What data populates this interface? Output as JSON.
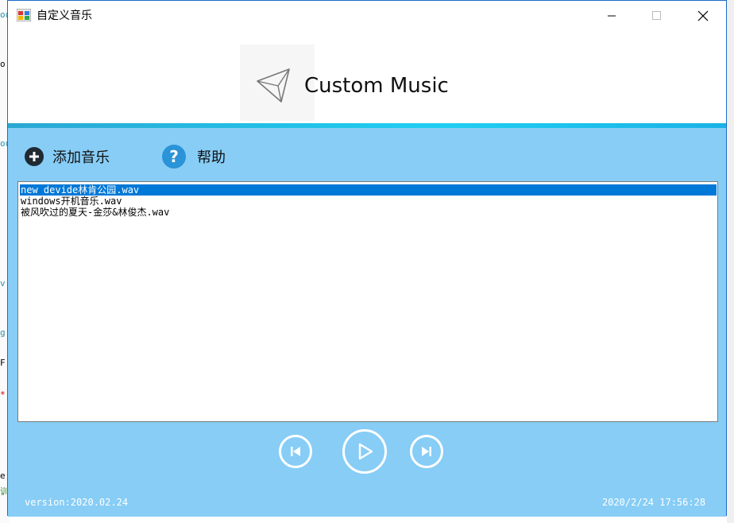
{
  "window": {
    "title": "自定义音乐"
  },
  "header": {
    "app_name": "Custom Music"
  },
  "toolbar": {
    "add_music_label": "添加音乐",
    "help_label": "帮助"
  },
  "playlist": {
    "items": [
      {
        "name": "new devide林肯公园.wav",
        "selected": true
      },
      {
        "name": "windows开机音乐.wav",
        "selected": false
      },
      {
        "name": "被风吹过的夏天-金莎&林俊杰.wav",
        "selected": false
      }
    ]
  },
  "controls": {
    "previous_icon": "skip-previous-icon",
    "play_icon": "play-icon",
    "next_icon": "skip-next-icon"
  },
  "footer": {
    "version": "version:2020.02.24",
    "datetime": "2020/2/24 17:56:28"
  },
  "colors": {
    "main_background": "#87cdf6",
    "selection": "#0078d7",
    "accent_bar": "#1fcff2"
  }
}
